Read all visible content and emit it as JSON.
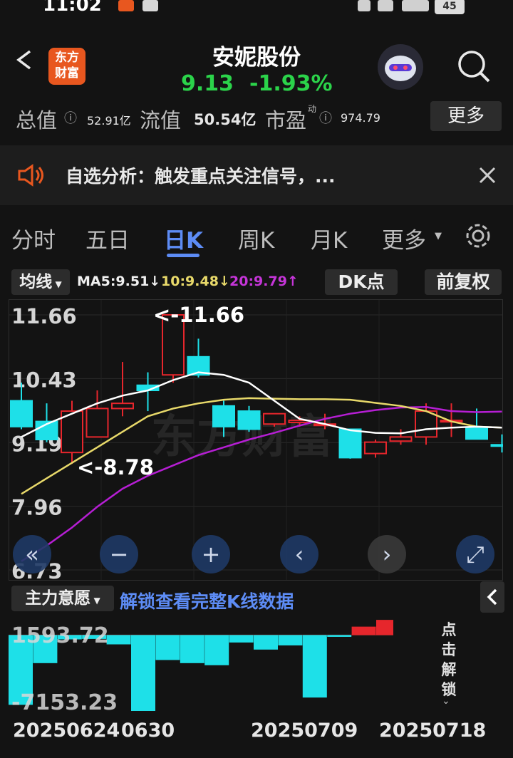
{
  "status_bar": {
    "time": "11:02",
    "battery": "45"
  },
  "header": {
    "logo_line1": "东方",
    "logo_line2": "财富",
    "title": "安妮股份",
    "price": "9.13",
    "change_pct": "-1.93%"
  },
  "metrics": {
    "total_label": "总值",
    "total_value": "52.91亿",
    "float_label": "流值",
    "float_value": "50.54亿",
    "pe_label": "市盈",
    "pe_sup": "动",
    "pe_value": "974.79",
    "more": "更多"
  },
  "notice": {
    "text": "自选分析：触发重点关注信号，..."
  },
  "tabs": [
    {
      "label": "分时"
    },
    {
      "label": "五日"
    },
    {
      "label": "日K"
    },
    {
      "label": "周K"
    },
    {
      "label": "月K"
    },
    {
      "label": "更多"
    }
  ],
  "chart_toolbar": {
    "indicator": "均线",
    "ma5": "MA5:9.51↓",
    "ma10": "10:9.48↓",
    "ma20": "20:9.79↑",
    "dk": "DK点",
    "adjust": "前复权"
  },
  "chart_data": {
    "type": "candlestick",
    "ylim": [
      6.73,
      11.66
    ],
    "y_ticks": [
      "11.66",
      "10.43",
      "9.19",
      "7.96",
      "6.73"
    ],
    "annotations": {
      "high": "<-11.66",
      "low": "<-8.78"
    },
    "watermark": "东方财富",
    "candles": [
      {
        "o": 10.0,
        "h": 10.35,
        "c": 9.5,
        "l": 9.45
      },
      {
        "o": 9.6,
        "h": 9.95,
        "c": 9.25,
        "l": 9.2
      },
      {
        "o": 9.0,
        "h": 10.0,
        "c": 9.8,
        "l": 8.78
      },
      {
        "o": 9.3,
        "h": 10.2,
        "c": 9.85,
        "l": 9.3
      },
      {
        "o": 9.85,
        "h": 10.75,
        "c": 9.95,
        "l": 9.7
      },
      {
        "o": 10.3,
        "h": 10.55,
        "c": 10.2,
        "l": 9.8
      },
      {
        "o": 10.5,
        "h": 11.66,
        "c": 11.66,
        "l": 10.35
      },
      {
        "o": 10.85,
        "h": 11.2,
        "c": 10.5,
        "l": 10.45
      },
      {
        "o": 9.9,
        "h": 10.0,
        "c": 9.5,
        "l": 9.3
      },
      {
        "o": 9.8,
        "h": 9.9,
        "c": 9.45,
        "l": 9.4
      },
      {
        "o": 9.55,
        "h": 9.75,
        "c": 9.75,
        "l": 9.5
      },
      {
        "o": 9.58,
        "h": 9.7,
        "c": 9.62,
        "l": 9.5
      },
      {
        "o": 9.53,
        "h": 9.75,
        "c": 9.55,
        "l": 9.45
      },
      {
        "o": 9.45,
        "h": 9.45,
        "c": 8.9,
        "l": 8.88
      },
      {
        "o": 8.98,
        "h": 9.25,
        "c": 9.2,
        "l": 8.9
      },
      {
        "o": 9.22,
        "h": 9.45,
        "c": 9.3,
        "l": 9.15
      },
      {
        "o": 9.3,
        "h": 9.95,
        "c": 9.8,
        "l": 9.15
      },
      {
        "o": 9.62,
        "h": 9.95,
        "c": 9.62,
        "l": 9.3
      },
      {
        "o": 9.48,
        "h": 9.85,
        "c": 9.26,
        "l": 9.26
      },
      {
        "o": 9.15,
        "h": 9.35,
        "c": 9.13,
        "l": 9.0
      }
    ],
    "ma5": [
      9.3,
      9.55,
      9.75,
      9.95,
      10.1,
      10.2,
      10.4,
      10.55,
      10.5,
      10.35,
      10.0,
      9.65,
      9.55,
      9.43,
      9.38,
      9.37,
      9.45,
      9.48,
      9.5,
      9.48
    ],
    "ma10": [
      8.2,
      8.5,
      8.8,
      9.1,
      9.4,
      9.7,
      9.85,
      9.95,
      10.02,
      10.05,
      10.04,
      10.03,
      10.03,
      10.02,
      9.96,
      9.9,
      9.8,
      9.6,
      9.5,
      9.48
    ],
    "ma20": [
      6.9,
      7.2,
      7.55,
      7.95,
      8.3,
      8.55,
      8.75,
      8.95,
      9.1,
      9.25,
      9.38,
      9.52,
      9.65,
      9.75,
      9.82,
      9.87,
      9.88,
      9.8,
      9.78,
      9.79
    ]
  },
  "chart_controls": [
    "«",
    "−",
    "+",
    "‹",
    "›",
    "⤢"
  ],
  "sub_chart": {
    "indicator": "主力意愿",
    "unlock_text": "解锁查看完整K线数据",
    "y_ticks": [
      "1593.72",
      "-7153.23"
    ],
    "side_text": "点击解锁",
    "bars": [
      -6700,
      -2700,
      -420,
      -380,
      -900,
      -7900,
      -2400,
      -2700,
      -2900,
      -720,
      -1400,
      -1000,
      -6000,
      -180,
      800,
      1450
    ]
  },
  "x_dates": [
    "20250624",
    "0630",
    "20250709",
    "20250718"
  ],
  "colors": {
    "up": "#e6262c",
    "down": "#1ee0e8",
    "ma5": "#ffffff",
    "ma10": "#e8d96a",
    "ma20": "#b61ed4",
    "accent": "#5d8cf5",
    "price": "#2bd34a"
  }
}
